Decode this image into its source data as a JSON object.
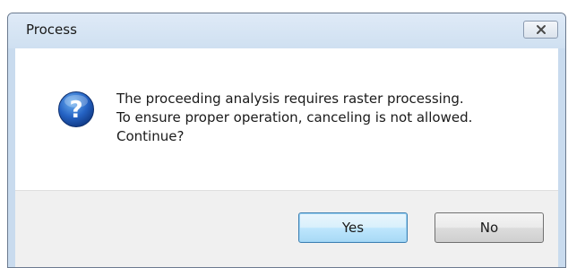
{
  "dialog": {
    "title": "Process",
    "close_icon": "close-icon",
    "question_icon": "question-icon",
    "message_lines": [
      "The proceeding analysis requires raster processing.",
      "To ensure proper operation, canceling is not allowed.",
      "Continue?"
    ],
    "buttons": {
      "yes_label": "Yes",
      "no_label": "No"
    }
  },
  "colors": {
    "frame": "#c9dbee",
    "icon_blue": "#1f5fb5",
    "default_button_border": "#3c7fb1"
  }
}
